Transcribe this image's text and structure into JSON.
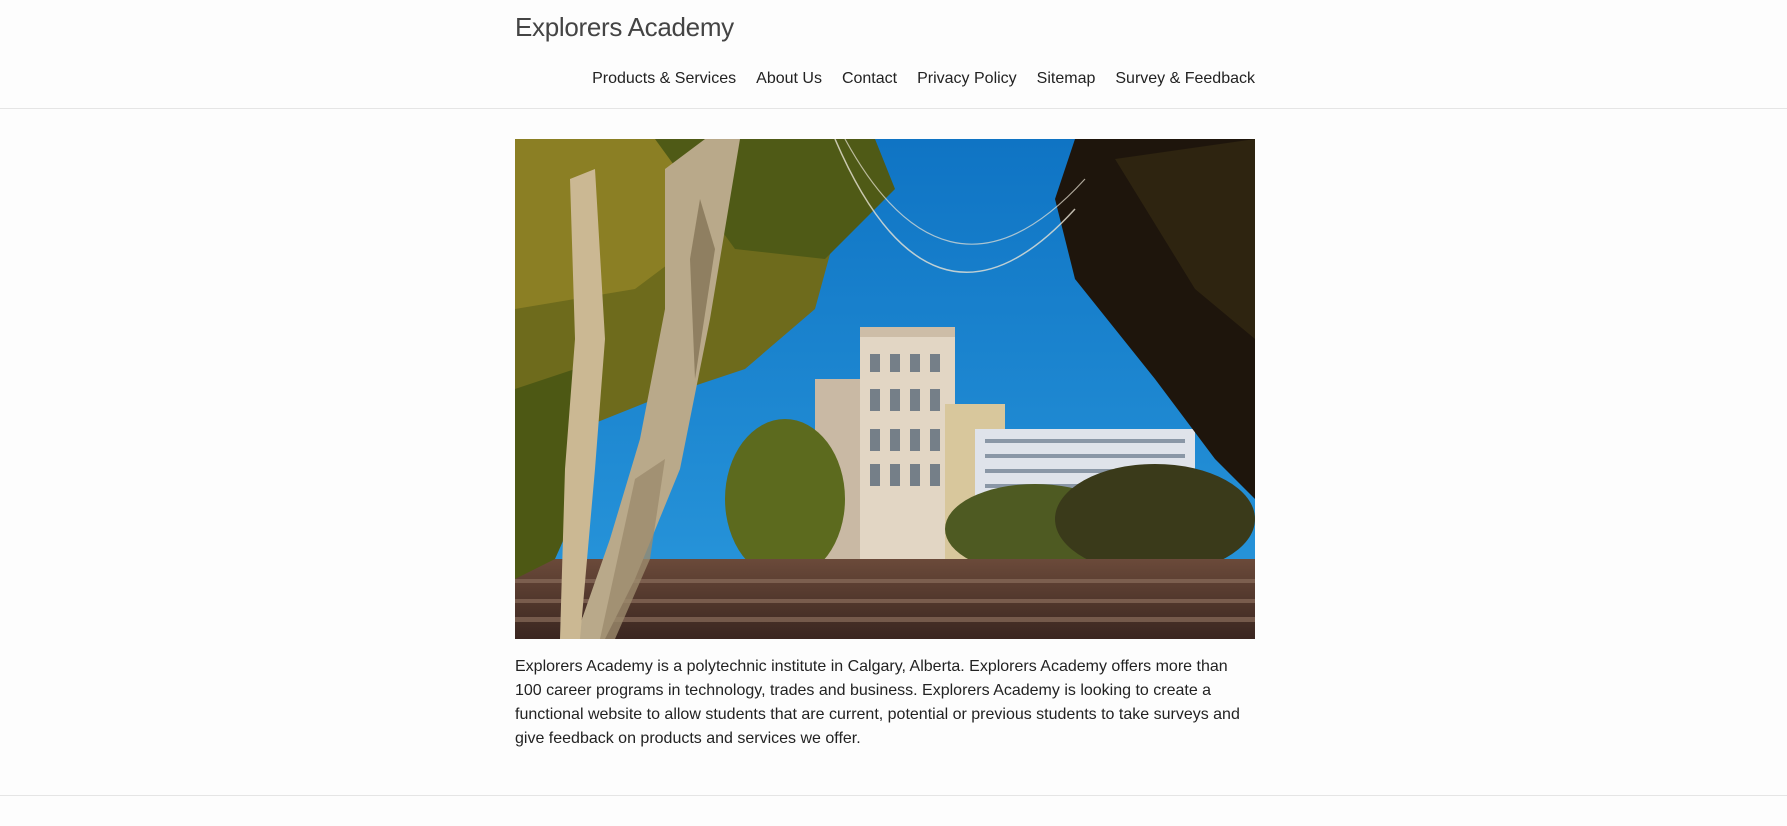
{
  "site": {
    "title": "Explorers Academy"
  },
  "nav": {
    "items": [
      {
        "label": "Products & Services"
      },
      {
        "label": "About Us"
      },
      {
        "label": "Contact"
      },
      {
        "label": "Privacy Policy"
      },
      {
        "label": "Sitemap"
      },
      {
        "label": "Survey & Feedback"
      }
    ]
  },
  "hero": {
    "alt": "Campus building framed by trees under a blue sky"
  },
  "intro": {
    "text": "Explorers Academy is a polytechnic institute in Calgary, Alberta. Explorers Academy offers more than 100 career programs in technology, trades and business. Explorers Academy is looking to create a functional website to allow students that are current, potential or previous students to take surveys and give feedback on products and services we offer."
  },
  "colors": {
    "background": "#fdfdfd",
    "text": "#222222",
    "divider": "#e5e5e5",
    "sky": "#1e86d0"
  }
}
